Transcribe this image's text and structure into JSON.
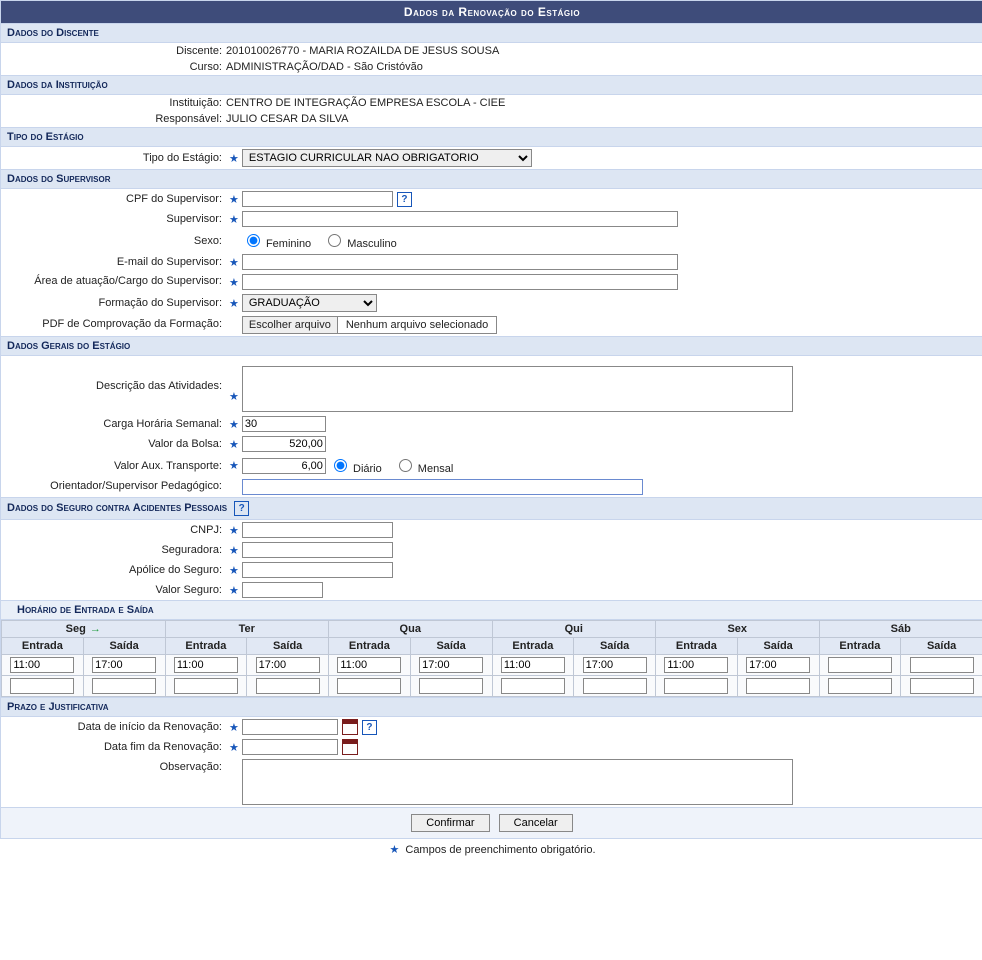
{
  "title": "Dados da Renovação do Estágio",
  "discente": {
    "header": "Dados do Discente",
    "discente_label": "Discente:",
    "discente_value": "201010026770 - MARIA ROZAILDA DE JESUS SOUSA",
    "curso_label": "Curso:",
    "curso_value": "ADMINISTRAÇÃO/DAD - São Cristóvão"
  },
  "instituicao": {
    "header": "Dados da Instituição",
    "inst_label": "Instituição:",
    "inst_value": "CENTRO DE INTEGRAÇÃO EMPRESA ESCOLA - CIEE",
    "resp_label": "Responsável:",
    "resp_value": "JULIO CESAR DA SILVA"
  },
  "tipo": {
    "header": "Tipo do Estágio",
    "label": "Tipo do Estágio:",
    "selected": "ESTAGIO CURRICULAR NAO OBRIGATORIO"
  },
  "supervisor": {
    "header": "Dados do Supervisor",
    "cpf_label": "CPF do Supervisor:",
    "nome_label": "Supervisor:",
    "sexo_label": "Sexo:",
    "sexo_f": "Feminino",
    "sexo_m": "Masculino",
    "email_label": "E-mail do Supervisor:",
    "area_label": "Área de atuação/Cargo do Supervisor:",
    "formacao_label": "Formação do Supervisor:",
    "formacao_selected": "GRADUAÇÃO",
    "pdf_label": "PDF de Comprovação da Formação:",
    "file_btn": "Escolher arquivo",
    "file_status": "Nenhum arquivo selecionado"
  },
  "gerais": {
    "header": "Dados Gerais do Estágio",
    "desc_label": "Descrição das Atividades:",
    "carga_label": "Carga Horária Semanal:",
    "carga_value": "30",
    "bolsa_label": "Valor da Bolsa:",
    "bolsa_value": "520,00",
    "aux_label": "Valor Aux. Transporte:",
    "aux_value": "6,00",
    "aux_diario": "Diário",
    "aux_mensal": "Mensal",
    "orientador_label": "Orientador/Supervisor Pedagógico:"
  },
  "seguro": {
    "header": "Dados do Seguro contra Acidentes Pessoais",
    "cnpj_label": "CNPJ:",
    "seguradora_label": "Seguradora:",
    "apolice_label": "Apólice do Seguro:",
    "valor_label": "Valor Seguro:"
  },
  "horario": {
    "header": "Horário de Entrada e Saída",
    "days": [
      "Seg",
      "Ter",
      "Qua",
      "Qui",
      "Sex",
      "Sáb"
    ],
    "entrada": "Entrada",
    "saida": "Saída",
    "rows": [
      [
        [
          "11:00",
          "17:00"
        ],
        [
          "11:00",
          "17:00"
        ],
        [
          "11:00",
          "17:00"
        ],
        [
          "11:00",
          "17:00"
        ],
        [
          "11:00",
          "17:00"
        ],
        [
          "",
          ""
        ]
      ],
      [
        [
          "",
          ""
        ],
        [
          "",
          ""
        ],
        [
          "",
          ""
        ],
        [
          "",
          ""
        ],
        [
          "",
          ""
        ],
        [
          "",
          ""
        ]
      ]
    ]
  },
  "prazo": {
    "header": "Prazo e Justificativa",
    "inicio_label": "Data de início da Renovação:",
    "fim_label": "Data fim da Renovação:",
    "obs_label": "Observação:"
  },
  "actions": {
    "confirmar": "Confirmar",
    "cancelar": "Cancelar"
  },
  "footnote": "Campos de preenchimento obrigatório."
}
